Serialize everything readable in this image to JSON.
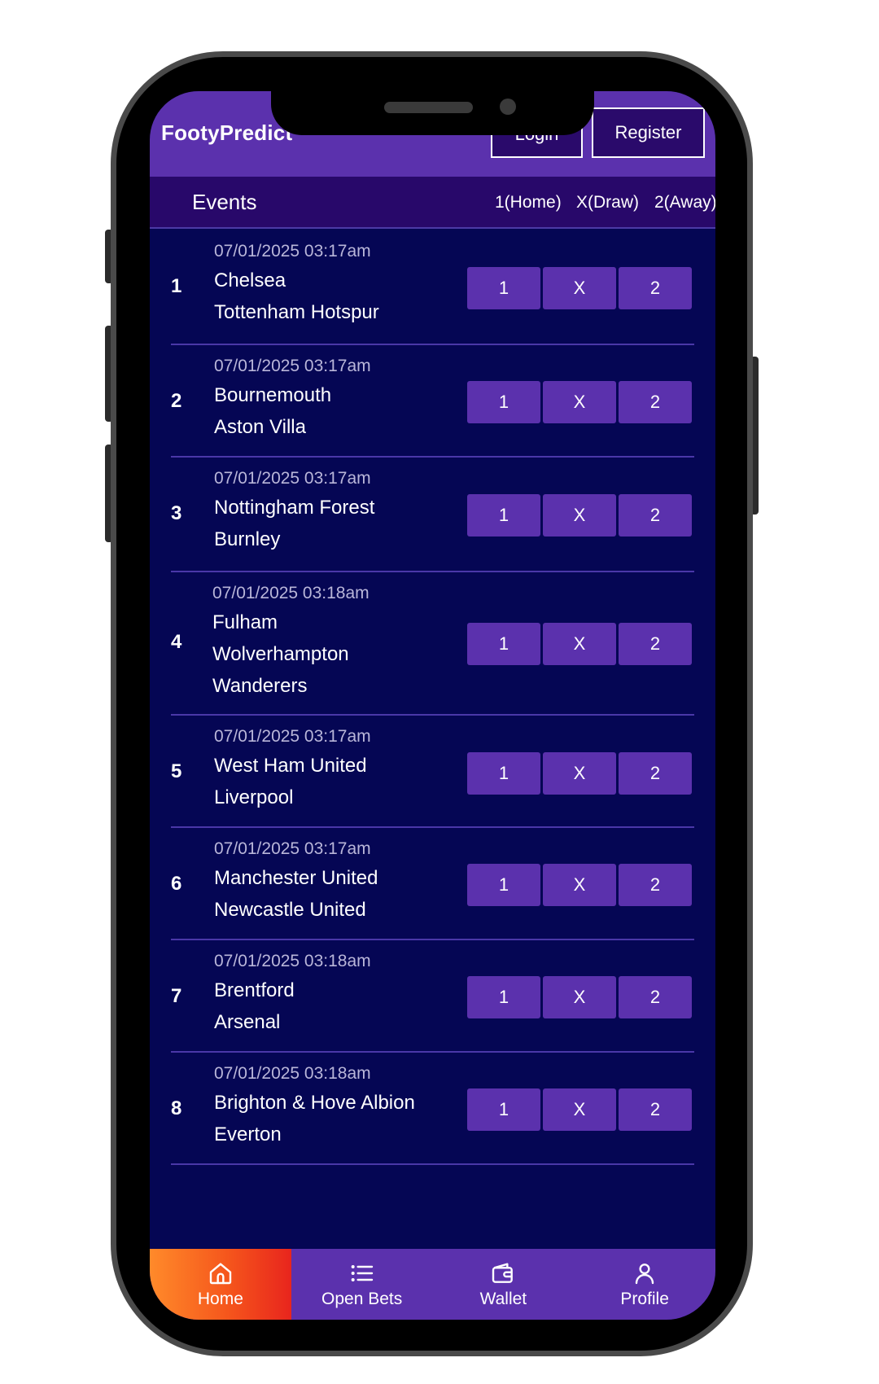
{
  "app": {
    "brand": "FootyPredict"
  },
  "header": {
    "login_label": "Login",
    "register_label": "Register"
  },
  "events": {
    "title": "Events",
    "col_home": "1(Home)",
    "col_draw": "X(Draw)",
    "col_away": "2(Away)"
  },
  "matches": [
    {
      "num": "1",
      "time": "07/01/2025 03:17am",
      "home": "Chelsea",
      "away": "Tottenham Hotspur",
      "odd1": "1",
      "oddx": "X",
      "odd2": "2"
    },
    {
      "num": "2",
      "time": "07/01/2025 03:17am",
      "home": "Bournemouth",
      "away": "Aston Villa",
      "odd1": "1",
      "oddx": "X",
      "odd2": "2"
    },
    {
      "num": "3",
      "time": "07/01/2025 03:17am",
      "home": "Nottingham Forest",
      "away": "Burnley",
      "odd1": "1",
      "oddx": "X",
      "odd2": "2"
    },
    {
      "num": "4",
      "time": "07/01/2025 03:18am",
      "home": "Fulham",
      "away": "Wolverhampton",
      "away2": "Wanderers",
      "odd1": "1",
      "oddx": "X",
      "odd2": "2"
    },
    {
      "num": "5",
      "time": "07/01/2025 03:17am",
      "home": "West Ham United",
      "away": "Liverpool",
      "odd1": "1",
      "oddx": "X",
      "odd2": "2"
    },
    {
      "num": "6",
      "time": "07/01/2025 03:17am",
      "home": "Manchester United",
      "away": "Newcastle United",
      "odd1": "1",
      "oddx": "X",
      "odd2": "2"
    },
    {
      "num": "7",
      "time": "07/01/2025 03:18am",
      "home": "Brentford",
      "away": "Arsenal",
      "odd1": "1",
      "oddx": "X",
      "odd2": "2"
    },
    {
      "num": "8",
      "time": "07/01/2025 03:18am",
      "home": "Brighton & Hove Albion",
      "away": "Everton",
      "odd1": "1",
      "oddx": "X",
      "odd2": "2"
    }
  ],
  "nav": {
    "home": "Home",
    "open_bets": "Open Bets",
    "wallet": "Wallet",
    "profile": "Profile"
  },
  "colors": {
    "primary": "#5b31ad",
    "background": "#050654",
    "header_dark": "#28086a",
    "active_gradient_start": "#ff8a2a",
    "active_gradient_end": "#e8251d"
  }
}
